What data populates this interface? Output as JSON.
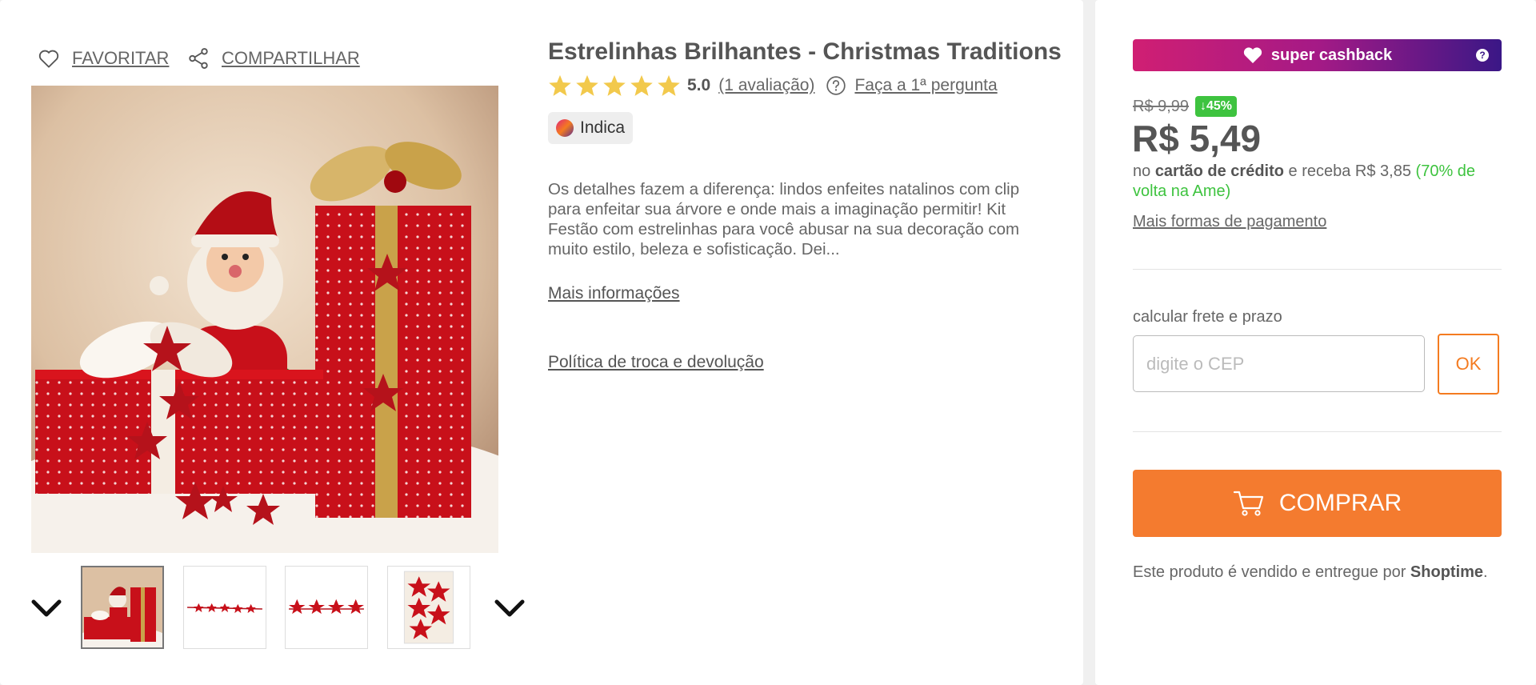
{
  "actions": {
    "favorite_label": "FAVORITAR",
    "share_label": "COMPARTILHAR"
  },
  "product": {
    "title": "Estrelinhas Brilhantes - Christmas Traditions",
    "rating": {
      "stars": 5,
      "value": "5.0",
      "reviews_label": "(1 avaliação)",
      "question_label": "Faça a 1ª pergunta"
    },
    "badge": "Indica",
    "description": "Os detalhes fazem a diferença: lindos enfeites natalinos com clip para enfeitar sua árvore e onde mais a imaginação permitir! Kit Festão com estrelinhas para você abusar na sua decoração com muito estilo, beleza e sofisticação. Dei...",
    "more_info_label": "Mais informações",
    "policy_label": "Política de troca e devolução"
  },
  "gallery": {
    "thumbnails": [
      "thumb-santa-gifts",
      "thumb-star-garland",
      "thumb-star-clips",
      "thumb-star-package"
    ]
  },
  "purchase": {
    "cashback_label": "super cashback",
    "help_icon": "?",
    "old_price": "R$ 9,99",
    "discount": "↓45%",
    "price": "R$ 5,49",
    "installment": {
      "prefix": "no ",
      "card": "cartão de crédito",
      "middle": " e receba R$ 3,85 ",
      "cashback": "(70% de volta na Ame)"
    },
    "more_payment_label": "Mais formas de pagamento",
    "shipping_label": "calcular frete e prazo",
    "cep_placeholder": "digite o CEP",
    "ok_label": "OK",
    "buy_label": "COMPRAR",
    "seller": {
      "prefix": "Este produto é vendido e entregue por ",
      "name": "Shoptime",
      "suffix": "."
    }
  },
  "colors": {
    "accent_orange": "#f47b2f",
    "discount_green": "#3ec33f",
    "star_yellow": "#f2c94c",
    "cashback_start": "#d01f73",
    "cashback_end": "#3a1786"
  }
}
